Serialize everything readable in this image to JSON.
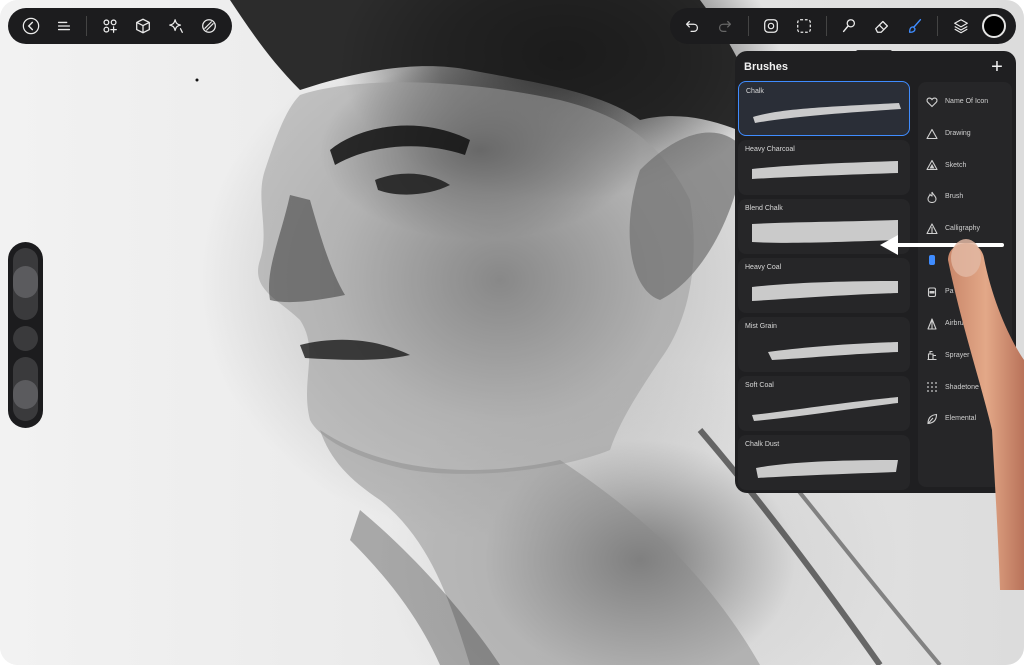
{
  "app": {
    "top_left": {
      "icons": [
        "back-icon",
        "menu-icon",
        "gallery-add-icon",
        "transform-3d-icon",
        "adjustments-sparkle-icon",
        "selection-overlap-icon"
      ]
    },
    "top_right": {
      "icons": [
        "undo-icon",
        "redo-icon",
        "smudge-face-icon",
        "selection-dashed-icon",
        "smudge-icon",
        "eraser-icon",
        "brush-icon",
        "layers-icon"
      ],
      "active_tool": "brush-icon",
      "current_color": "#000000"
    }
  },
  "sidebar": {
    "size_slider_level": 0.55,
    "opacity_slider_level": 0.35
  },
  "brushes_panel": {
    "title": "Brushes",
    "add_label": "+",
    "brushes": [
      {
        "name": "Chalk",
        "selected": true
      },
      {
        "name": "Heavy Charcoal",
        "selected": false
      },
      {
        "name": "Blend Chalk",
        "selected": false
      },
      {
        "name": "Heavy Coal",
        "selected": false
      },
      {
        "name": "Mist Grain",
        "selected": false
      },
      {
        "name": "Soft Coal",
        "selected": false
      },
      {
        "name": "Chalk Dust",
        "selected": false
      }
    ],
    "categories": [
      {
        "name": "Name Of Icon",
        "icon": "heart-icon"
      },
      {
        "name": "Drawing",
        "icon": "triangle-icon"
      },
      {
        "name": "Sketch",
        "icon": "triangle-filled-icon"
      },
      {
        "name": "Brush",
        "icon": "flame-icon"
      },
      {
        "name": "Calligraphy",
        "icon": "pen-nib-icon"
      },
      {
        "name": "",
        "icon": "marker-icon",
        "active": true
      },
      {
        "name": "Pa",
        "icon": "paint-pot-icon"
      },
      {
        "name": "Airbrus",
        "icon": "airbrush-icon"
      },
      {
        "name": "Sprayer",
        "icon": "sprayer-icon"
      },
      {
        "name": "Shadetone",
        "icon": "halftone-grid-icon"
      },
      {
        "name": "Elemental",
        "icon": "leaf-icon"
      }
    ]
  },
  "accent_color": "#3f8cff"
}
